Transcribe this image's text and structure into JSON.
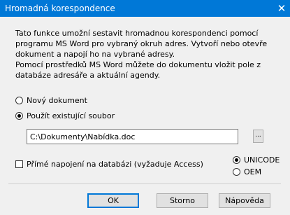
{
  "window": {
    "title": "Hromadná korespondence",
    "close_glyph": "✕"
  },
  "description": {
    "line1": "Tato funkce umožní sestavit hromadnou korespondenci pomocí",
    "line2": "programu MS Word pro vybraný okruh adres. Vytvoří nebo otevře",
    "line3": "dokument a napojí ho na vybrané adresy.",
    "line4": "Pomocí prostředků MS Word můžete do dokumentu vložit pole z",
    "line5": "databáze adresáře a aktuální agendy."
  },
  "document_options": {
    "new_label": "Nový dokument",
    "new_selected": false,
    "existing_label": "Použít existující soubor",
    "existing_selected": true
  },
  "file_path": {
    "value": "C:\\Dokumenty\\Nabídka.doc",
    "browse_label": "..."
  },
  "direct_db": {
    "label": "Přímé napojení na databázi (vyžaduje Access)",
    "checked": false
  },
  "encoding": {
    "unicode_label": "UNICODE",
    "unicode_selected": true,
    "oem_label": "OEM",
    "oem_selected": false
  },
  "buttons": {
    "ok": "OK",
    "cancel": "Storno",
    "help": "Nápověda"
  },
  "colors": {
    "titlebar": "#0078d7",
    "dialog_bg": "#f0f0f0"
  }
}
